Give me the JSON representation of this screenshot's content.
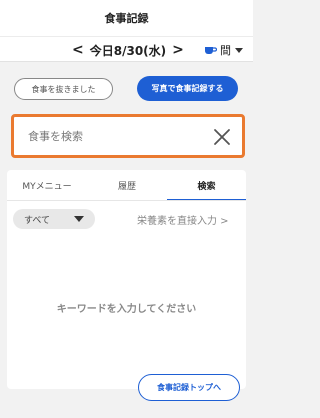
{
  "header": {
    "title": "食事記録"
  },
  "date_nav": {
    "prev_icon": "chevron-left",
    "date": "今日8/30(水)",
    "next_icon": "chevron-right",
    "meal": {
      "label": "間",
      "icon": "cup-icon"
    }
  },
  "actions": {
    "skip_label": "食事を抜きました",
    "photo_label": "写真で食事記録する"
  },
  "search": {
    "placeholder": "食事を検索",
    "value": ""
  },
  "tabs": [
    {
      "label": "MYメニュー",
      "active": false
    },
    {
      "label": "履歴",
      "active": false
    },
    {
      "label": "検索",
      "active": true
    }
  ],
  "filter": {
    "selected": "すべて",
    "direct_input_label": "栄養素を直接入力 >"
  },
  "empty_message": "キーワードを入力してください",
  "footer": {
    "top_link_label": "食事記録トップへ"
  },
  "colors": {
    "accent": "#1e5fd4",
    "focus_border": "#ea7a30",
    "background": "#f2f2f2"
  }
}
